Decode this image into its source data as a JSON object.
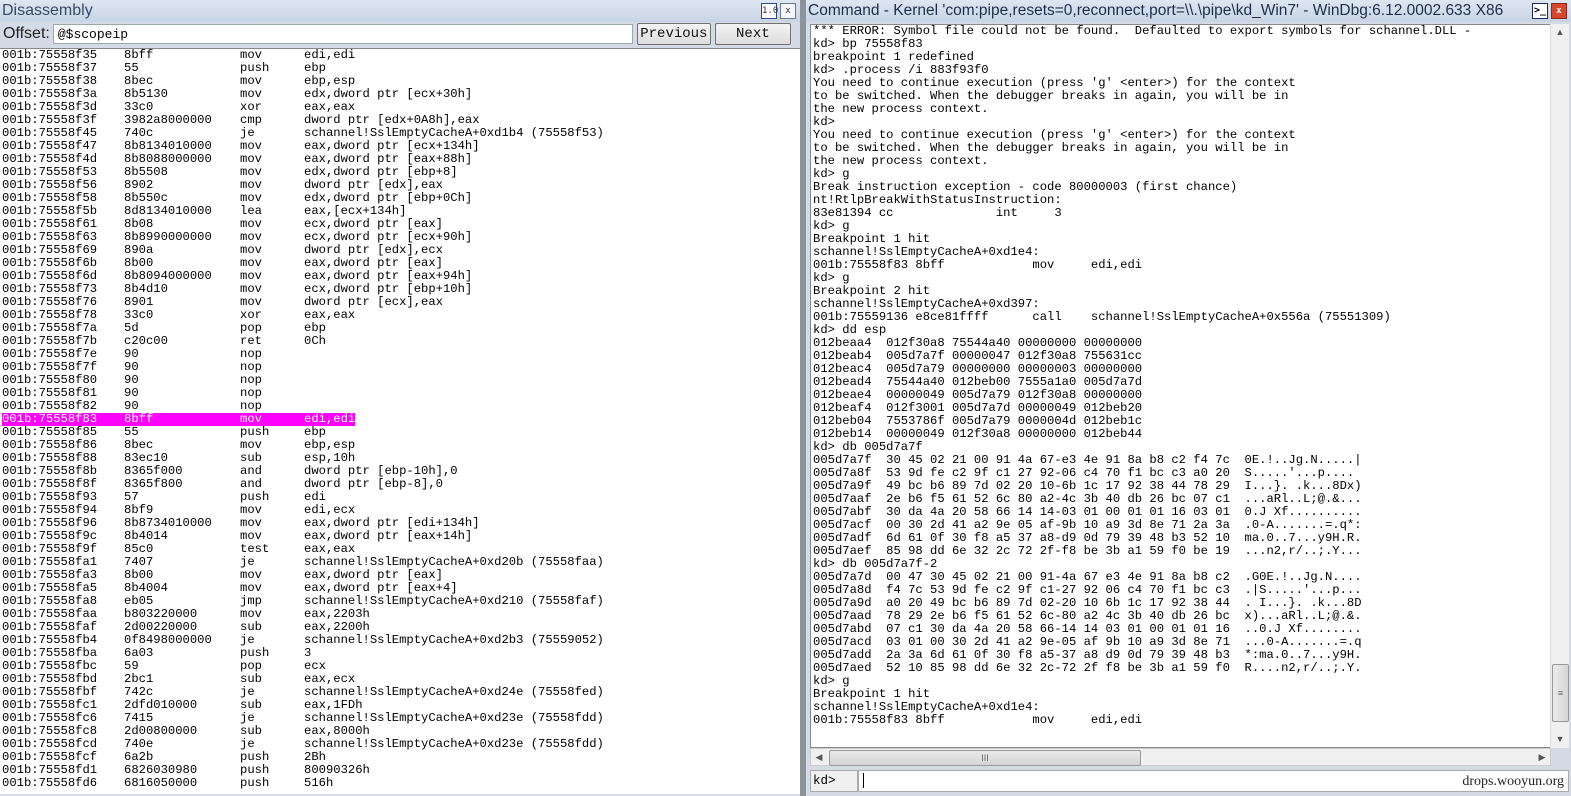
{
  "disassembly": {
    "title": "Disassembly",
    "offset_label": "Offset:",
    "offset_value": "@$scopeip",
    "previous_label": "Previous",
    "next_label": "Next",
    "icons": [
      "source-mode-icon",
      "close-icon"
    ],
    "highlight_color": "#ff00ff",
    "highlighted_index": 28,
    "rows": [
      [
        "001b:75558f35",
        "8bff",
        "mov",
        "edi,edi"
      ],
      [
        "001b:75558f37",
        "55",
        "push",
        "ebp"
      ],
      [
        "001b:75558f38",
        "8bec",
        "mov",
        "ebp,esp"
      ],
      [
        "001b:75558f3a",
        "8b5130",
        "mov",
        "edx,dword ptr [ecx+30h]"
      ],
      [
        "001b:75558f3d",
        "33c0",
        "xor",
        "eax,eax"
      ],
      [
        "001b:75558f3f",
        "3982a8000000",
        "cmp",
        "dword ptr [edx+0A8h],eax"
      ],
      [
        "001b:75558f45",
        "740c",
        "je",
        "schannel!SslEmptyCacheA+0xd1b4 (75558f53)"
      ],
      [
        "001b:75558f47",
        "8b8134010000",
        "mov",
        "eax,dword ptr [ecx+134h]"
      ],
      [
        "001b:75558f4d",
        "8b8088000000",
        "mov",
        "eax,dword ptr [eax+88h]"
      ],
      [
        "001b:75558f53",
        "8b5508",
        "mov",
        "edx,dword ptr [ebp+8]"
      ],
      [
        "001b:75558f56",
        "8902",
        "mov",
        "dword ptr [edx],eax"
      ],
      [
        "001b:75558f58",
        "8b550c",
        "mov",
        "edx,dword ptr [ebp+0Ch]"
      ],
      [
        "001b:75558f5b",
        "8d8134010000",
        "lea",
        "eax,[ecx+134h]"
      ],
      [
        "001b:75558f61",
        "8b08",
        "mov",
        "ecx,dword ptr [eax]"
      ],
      [
        "001b:75558f63",
        "8b8990000000",
        "mov",
        "ecx,dword ptr [ecx+90h]"
      ],
      [
        "001b:75558f69",
        "890a",
        "mov",
        "dword ptr [edx],ecx"
      ],
      [
        "001b:75558f6b",
        "8b00",
        "mov",
        "eax,dword ptr [eax]"
      ],
      [
        "001b:75558f6d",
        "8b8094000000",
        "mov",
        "eax,dword ptr [eax+94h]"
      ],
      [
        "001b:75558f73",
        "8b4d10",
        "mov",
        "ecx,dword ptr [ebp+10h]"
      ],
      [
        "001b:75558f76",
        "8901",
        "mov",
        "dword ptr [ecx],eax"
      ],
      [
        "001b:75558f78",
        "33c0",
        "xor",
        "eax,eax"
      ],
      [
        "001b:75558f7a",
        "5d",
        "pop",
        "ebp"
      ],
      [
        "001b:75558f7b",
        "c20c00",
        "ret",
        "0Ch"
      ],
      [
        "001b:75558f7e",
        "90",
        "nop",
        ""
      ],
      [
        "001b:75558f7f",
        "90",
        "nop",
        ""
      ],
      [
        "001b:75558f80",
        "90",
        "nop",
        ""
      ],
      [
        "001b:75558f81",
        "90",
        "nop",
        ""
      ],
      [
        "001b:75558f82",
        "90",
        "nop",
        ""
      ],
      [
        "001b:75558f83",
        "8bff",
        "mov",
        "edi,edi"
      ],
      [
        "001b:75558f85",
        "55",
        "push",
        "ebp"
      ],
      [
        "001b:75558f86",
        "8bec",
        "mov",
        "ebp,esp"
      ],
      [
        "001b:75558f88",
        "83ec10",
        "sub",
        "esp,10h"
      ],
      [
        "001b:75558f8b",
        "8365f000",
        "and",
        "dword ptr [ebp-10h],0"
      ],
      [
        "001b:75558f8f",
        "8365f800",
        "and",
        "dword ptr [ebp-8],0"
      ],
      [
        "001b:75558f93",
        "57",
        "push",
        "edi"
      ],
      [
        "001b:75558f94",
        "8bf9",
        "mov",
        "edi,ecx"
      ],
      [
        "001b:75558f96",
        "8b8734010000",
        "mov",
        "eax,dword ptr [edi+134h]"
      ],
      [
        "001b:75558f9c",
        "8b4014",
        "mov",
        "eax,dword ptr [eax+14h]"
      ],
      [
        "001b:75558f9f",
        "85c0",
        "test",
        "eax,eax"
      ],
      [
        "001b:75558fa1",
        "7407",
        "je",
        "schannel!SslEmptyCacheA+0xd20b (75558faa)"
      ],
      [
        "001b:75558fa3",
        "8b00",
        "mov",
        "eax,dword ptr [eax]"
      ],
      [
        "001b:75558fa5",
        "8b4004",
        "mov",
        "eax,dword ptr [eax+4]"
      ],
      [
        "001b:75558fa8",
        "eb05",
        "jmp",
        "schannel!SslEmptyCacheA+0xd210 (75558faf)"
      ],
      [
        "001b:75558faa",
        "b803220000",
        "mov",
        "eax,2203h"
      ],
      [
        "001b:75558faf",
        "2d00220000",
        "sub",
        "eax,2200h"
      ],
      [
        "001b:75558fb4",
        "0f8498000000",
        "je",
        "schannel!SslEmptyCacheA+0xd2b3 (75559052)"
      ],
      [
        "001b:75558fba",
        "6a03",
        "push",
        "3"
      ],
      [
        "001b:75558fbc",
        "59",
        "pop",
        "ecx"
      ],
      [
        "001b:75558fbd",
        "2bc1",
        "sub",
        "eax,ecx"
      ],
      [
        "001b:75558fbf",
        "742c",
        "je",
        "schannel!SslEmptyCacheA+0xd24e (75558fed)"
      ],
      [
        "001b:75558fc1",
        "2dfd010000",
        "sub",
        "eax,1FDh"
      ],
      [
        "001b:75558fc6",
        "7415",
        "je",
        "schannel!SslEmptyCacheA+0xd23e (75558fdd)"
      ],
      [
        "001b:75558fc8",
        "2d00800000",
        "sub",
        "eax,8000h"
      ],
      [
        "001b:75558fcd",
        "740e",
        "je",
        "schannel!SslEmptyCacheA+0xd23e (75558fdd)"
      ],
      [
        "001b:75558fcf",
        "6a2b",
        "push",
        "2Bh"
      ],
      [
        "001b:75558fd1",
        "6826030980",
        "push",
        "80090326h"
      ],
      [
        "001b:75558fd6",
        "6816050000",
        "push",
        "516h"
      ]
    ]
  },
  "command": {
    "title": "Command - Kernel 'com:pipe,resets=0,reconnect,port=\\\\.\\pipe\\kd_Win7' - WinDbg:6.12.0002.633 X86",
    "icons": [
      "command-window-icon",
      "close-icon"
    ],
    "prompt": "kd>",
    "input_value": "",
    "watermark": "drops.wooyun.org",
    "scroll_h_label": "III",
    "scroll_v_label": "≡",
    "lines": [
      "*** ERROR: Symbol file could not be found.  Defaulted to export symbols for schannel.DLL -",
      "kd> bp 75558f83",
      "breakpoint 1 redefined",
      "kd> .process /i 883f93f0",
      "You need to continue execution (press 'g' <enter>) for the context",
      "to be switched. When the debugger breaks in again, you will be in",
      "the new process context.",
      "kd>",
      "You need to continue execution (press 'g' <enter>) for the context",
      "to be switched. When the debugger breaks in again, you will be in",
      "the new process context.",
      "kd> g",
      "Break instruction exception - code 80000003 (first chance)",
      "nt!RtlpBreakWithStatusInstruction:",
      "83e81394 cc              int     3",
      "kd> g",
      "Breakpoint 1 hit",
      "schannel!SslEmptyCacheA+0xd1e4:",
      "001b:75558f83 8bff            mov     edi,edi",
      "kd> g",
      "Breakpoint 2 hit",
      "schannel!SslEmptyCacheA+0xd397:",
      "001b:75559136 e8ce81ffff      call    schannel!SslEmptyCacheA+0x556a (75551309)",
      "kd> dd esp",
      "012beaa4  012f30a8 75544a40 00000000 00000000",
      "012beab4  005d7a7f 00000047 012f30a8 755631cc",
      "012beac4  005d7a79 00000000 00000003 00000000",
      "012bead4  75544a40 012beb00 7555a1a0 005d7a7d",
      "012beae4  00000049 005d7a79 012f30a8 00000000",
      "012beaf4  012f3001 005d7a7d 00000049 012beb20",
      "012beb04  7553786f 005d7a79 0000004d 012beb1c",
      "012beb14  00000049 012f30a8 00000000 012beb44",
      "kd> db 005d7a7f",
      "005d7a7f  30 45 02 21 00 91 4a 67-e3 4e 91 8a b8 c2 f4 7c  0E.!..Jg.N.....|",
      "005d7a8f  53 9d fe c2 9f c1 27 92-06 c4 70 f1 bc c3 a0 20  S.....'...p.... ",
      "005d7a9f  49 bc b6 89 7d 02 20 10-6b 1c 17 92 38 44 78 29  I...}. .k...8Dx)",
      "005d7aaf  2e b6 f5 61 52 6c 80 a2-4c 3b 40 db 26 bc 07 c1  ...aRl..L;@.&...",
      "005d7abf  30 da 4a 20 58 66 14 14-03 01 00 01 01 16 03 01  0.J Xf..........",
      "005d7acf  00 30 2d 41 a2 9e 05 af-9b 10 a9 3d 8e 71 2a 3a  .0-A.......=.q*:",
      "005d7adf  6d 61 0f 30 f8 a5 37 a8-d9 0d 79 39 48 b3 52 10  ma.0..7...y9H.R.",
      "005d7aef  85 98 dd 6e 32 2c 72 2f-f8 be 3b a1 59 f0 be 19  ...n2,r/..;.Y...",
      "kd> db 005d7a7f-2",
      "005d7a7d  00 47 30 45 02 21 00 91-4a 67 e3 4e 91 8a b8 c2  .G0E.!..Jg.N....",
      "005d7a8d  f4 7c 53 9d fe c2 9f c1-27 92 06 c4 70 f1 bc c3  .|S.....'...p...",
      "005d7a9d  a0 20 49 bc b6 89 7d 02-20 10 6b 1c 17 92 38 44  . I...}. .k...8D",
      "005d7aad  78 29 2e b6 f5 61 52 6c-80 a2 4c 3b 40 db 26 bc  x)...aRl..L;@.&.",
      "005d7abd  07 c1 30 da 4a 20 58 66-14 14 03 01 00 01 01 16  ..0.J Xf........",
      "005d7acd  03 01 00 30 2d 41 a2 9e-05 af 9b 10 a9 3d 8e 71  ...0-A.......=.q",
      "005d7add  2a 3a 6d 61 0f 30 f8 a5-37 a8 d9 0d 79 39 48 b3  *:ma.0..7...y9H.",
      "005d7aed  52 10 85 98 dd 6e 32 2c-72 2f f8 be 3b a1 59 f0  R....n2,r/..;.Y.",
      "kd> g",
      "Breakpoint 1 hit",
      "schannel!SslEmptyCacheA+0xd1e4:",
      "001b:75558f83 8bff            mov     edi,edi"
    ]
  }
}
